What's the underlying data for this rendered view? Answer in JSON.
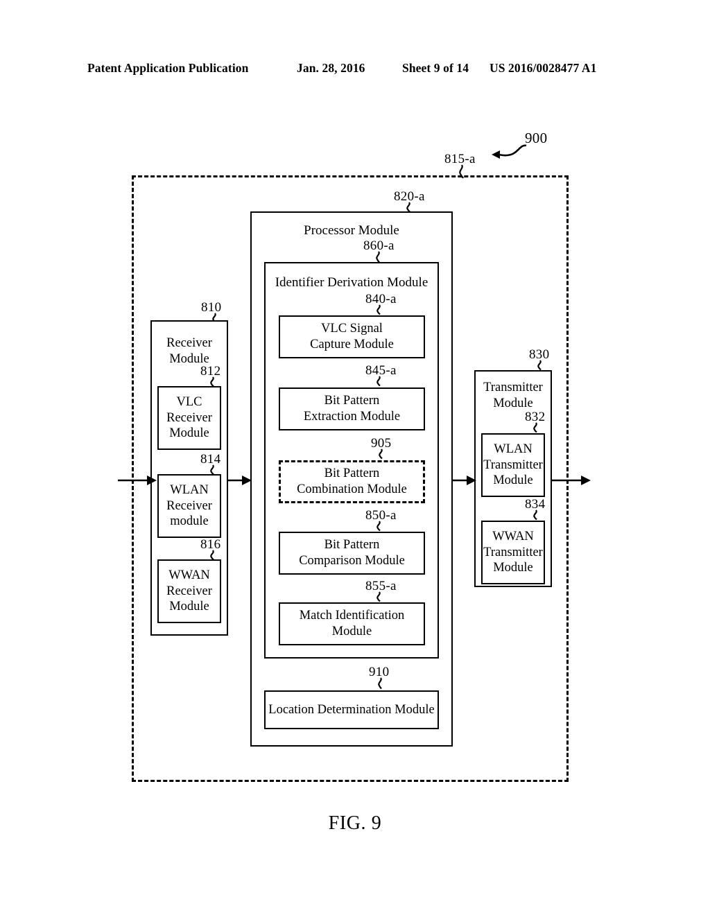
{
  "header": {
    "publication": "Patent Application Publication",
    "date": "Jan. 28, 2016",
    "sheet": "Sheet 9 of 14",
    "patent_number": "US 2016/0028477 A1"
  },
  "figure": {
    "caption": "FIG. 9",
    "system_ref": "900",
    "boundary_ref": "815-a"
  },
  "receiver": {
    "ref": "810",
    "label": "Receiver\nModule",
    "label_line1": "Receiver",
    "label_line2": "Module",
    "children": [
      {
        "ref": "812",
        "line1": "VLC",
        "line2": "Receiver",
        "line3": "Module"
      },
      {
        "ref": "814",
        "line1": "WLAN",
        "line2": "Receiver",
        "line3": "module"
      },
      {
        "ref": "816",
        "line1": "WWAN",
        "line2": "Receiver",
        "line3": "Module"
      }
    ]
  },
  "processor": {
    "ref": "820-a",
    "label": "Processor Module",
    "identifier_derivation": {
      "ref": "860-a",
      "label": "Identifier Derivation Module",
      "children": [
        {
          "ref": "840-a",
          "line1": "VLC Signal",
          "line2": "Capture Module",
          "style": "solid"
        },
        {
          "ref": "845-a",
          "line1": "Bit Pattern",
          "line2": "Extraction Module",
          "style": "solid"
        },
        {
          "ref": "905",
          "line1": "Bit Pattern",
          "line2": "Combination Module",
          "style": "dashed"
        },
        {
          "ref": "850-a",
          "line1": "Bit Pattern",
          "line2": "Comparison Module",
          "style": "solid"
        },
        {
          "ref": "855-a",
          "line1": "Match Identification",
          "line2": "Module",
          "style": "solid"
        }
      ]
    },
    "location_determination": {
      "ref": "910",
      "label": "Location Determination Module"
    }
  },
  "transmitter": {
    "ref": "830",
    "label_line1": "Transmitter",
    "label_line2": "Module",
    "children": [
      {
        "ref": "832",
        "line1": "WLAN",
        "line2": "Transmitter",
        "line3": "Module"
      },
      {
        "ref": "834",
        "line1": "WWAN",
        "line2": "Transmitter",
        "line3": "Module"
      }
    ]
  },
  "colors": {
    "ink": "#000000",
    "paper": "#ffffff"
  }
}
